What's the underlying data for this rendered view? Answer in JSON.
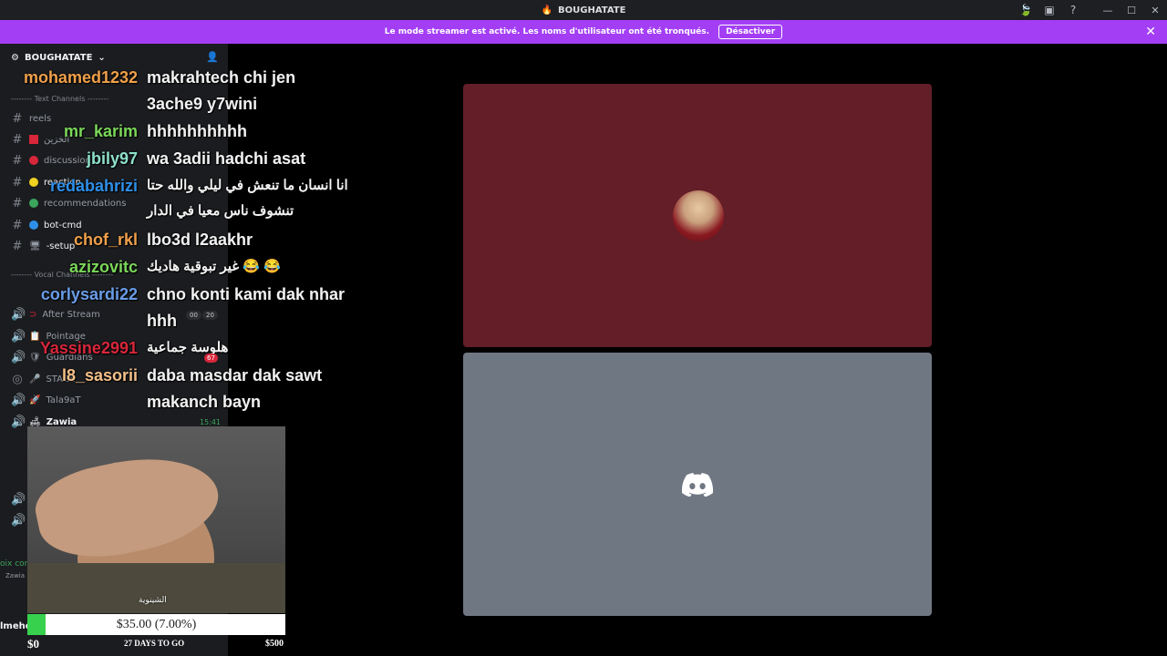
{
  "window": {
    "title": "BOUGHATATE"
  },
  "banner": {
    "message": "Le mode streamer est activé. Les noms d'utilisateur ont été tronqués.",
    "button": "Désactiver"
  },
  "sidebar": {
    "server_name": "BOUGHATATE",
    "text_category": "-------- Text Channels --------",
    "voice_category": "-------- Vocal Channels --------",
    "text_channels": [
      {
        "label": "reels"
      },
      {
        "label": "الخزين"
      },
      {
        "label": "discussion"
      },
      {
        "label": "reaction"
      },
      {
        "label": "recommendations"
      },
      {
        "label": "bot-cmd"
      },
      {
        "label": "-setup"
      }
    ],
    "voice_channels": [
      {
        "label": "After Stream"
      },
      {
        "label": "Pointage"
      },
      {
        "label": "Guardians"
      },
      {
        "label": "STAGE"
      },
      {
        "label": "Tala9aT"
      },
      {
        "label": "Zawia",
        "time": "15:41"
      }
    ],
    "badges": {
      "after_stream_a": "00",
      "after_stream_b": "20",
      "guardians": "67"
    },
    "voice_connected": "oix cor",
    "voice_channel_sub": "Zawia",
    "user_stub": "lmehd"
  },
  "chat": [
    {
      "user": "mohamed1232",
      "color": "#f0a04b",
      "message": "makrahtech chi jen"
    },
    {
      "user": "",
      "color": "#f2f2f2",
      "message": "3ache9 y7wini"
    },
    {
      "user": "mr_karim",
      "color": "#7bd85a",
      "message": "hhhhhhhhhh"
    },
    {
      "user": "jbily97",
      "color": "#8ee0c9",
      "message": "wa 3adii hadchi asat"
    },
    {
      "user": "redabahrizi",
      "color": "#2f8fe8",
      "message": "انا انسان ما تنعش في ليلي والله حتا"
    },
    {
      "user": "",
      "color": "#f2f2f2",
      "message": "تنشوف ناس معيا في الدار"
    },
    {
      "user": "chof_rkl",
      "color": "#f0a04b",
      "message": "lbo3d l2aakhr"
    },
    {
      "user": "azizovitc",
      "color": "#7bd85a",
      "message": "غير تبوقية هاديك 😂 😂"
    },
    {
      "user": "corlysardi22",
      "color": "#6a9de8",
      "message": "chno konti kami dak nhar"
    },
    {
      "user": "",
      "color": "#f2f2f2",
      "message": "hhh"
    },
    {
      "user": "Yassine2991",
      "color": "#d8263a",
      "message": "هلوسة جماعية"
    },
    {
      "user": "l8_sasorii",
      "color": "#f5c08a",
      "message": "daba masdar dak sawt"
    },
    {
      "user": "",
      "color": "#f2f2f2",
      "message": "makanch bayn"
    }
  ],
  "webcam": {
    "tag": "الشينوية"
  },
  "goal": {
    "text": "$35.00 (7.00%)",
    "progress": 0.07,
    "min": "$0",
    "max": "$500",
    "days": "27 DAYS TO GO"
  },
  "colors": {
    "banner": "#a33ef5",
    "tile_top": "#631e27",
    "tile_bottom": "#6f7782",
    "goal_fill": "#37d14e"
  }
}
